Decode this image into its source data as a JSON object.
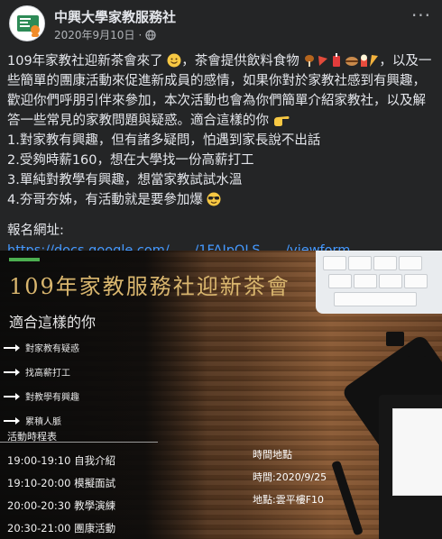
{
  "post": {
    "page_name": "中興大學家教服務社",
    "date": "2020年9月10日",
    "separator": "·",
    "body": {
      "p1": "109年家教社迎新茶會來了",
      "p1b": "，茶會提供飲料食物",
      "p1c": "，以及一些簡單的團康活動來促進新成員的感情，如果你對於家教社感到有興趣，歡迎你們呼朋引伴來參加，本次活動也會為你們簡單介紹家教社，以及解答一些常見的家教問題與疑惑。適合這樣的你",
      "items": [
        "1.對家教有興趣，但有諸多疑問，怕遇到家長說不出話",
        "2.受夠時薪160，想在大學找一份高薪打工",
        "3.單純對教學有興趣，想當家教試試水溫",
        "4.夯哥夯姊，有活動就是要參加爆"
      ],
      "signup_label": "報名網址:",
      "signup_link": "https://docs.google.com/....../1FAIpQLS....../viewform......"
    }
  },
  "image": {
    "title": "109年家教服務社迎新茶會",
    "subtitle": "適合這樣的你",
    "bullets": [
      "對家教有疑惑",
      "找高薪打工",
      "對教學有興趣",
      "累積人脈"
    ],
    "schedule_title": "活動時程表",
    "schedule": [
      "19:00-19:10 自我介紹",
      "19:10-20:00 模擬面試",
      "20:00-20:30 教學演練",
      "20:30-21:00 團康活動"
    ],
    "venue_title": "時間地點",
    "venue_time": "時間:2020/9/25",
    "venue_place": "地點:雲平樓F10"
  },
  "icons": {
    "avatar": "page-logo-icon",
    "privacy": "globe-icon",
    "more": "more-options-icon",
    "smile": "smile-emoji-icon",
    "food": "food-emoji-icons",
    "pointing": "pointing-emoji-icon",
    "cool": "sunglasses-emoji-icon"
  },
  "colors": {
    "background": "#242526",
    "link": "#4599ff",
    "accent_green": "#4caf50",
    "title_gold": "#d9b66e"
  }
}
